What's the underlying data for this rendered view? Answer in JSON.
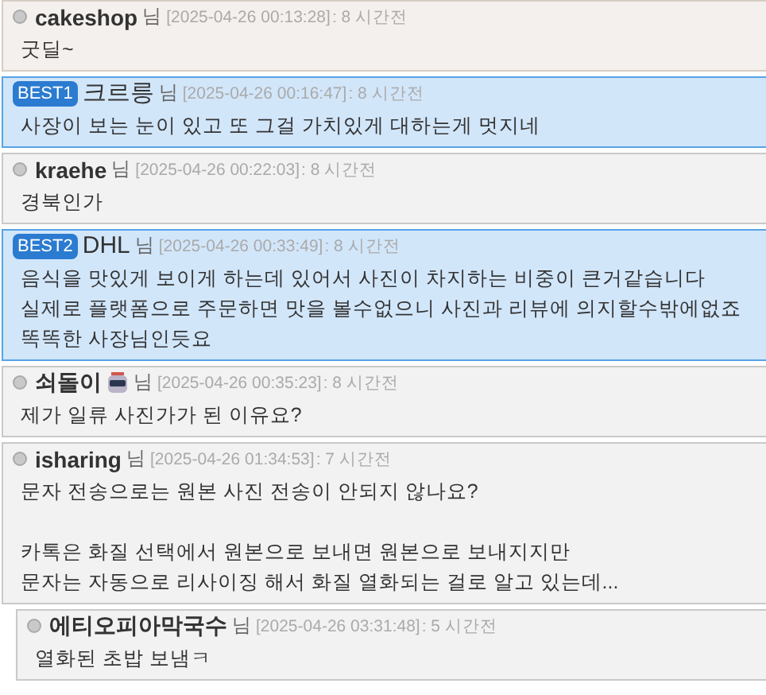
{
  "comments": [
    {
      "kind": "highlighted",
      "author": "cakeshop",
      "user_icon": false,
      "suffix": "님",
      "date": "[2025-04-26 00:13:28]",
      "ago": ": 8 시간전",
      "text": "굿딜~"
    },
    {
      "kind": "best",
      "badge": "BEST1",
      "author": "크르릉",
      "user_icon": false,
      "suffix": "님",
      "date": "[2025-04-26 00:16:47]",
      "ago": ": 8 시간전",
      "text": "사장이 보는 눈이 있고 또 그걸 가치있게 대하는게 멋지네"
    },
    {
      "kind": "normal",
      "author": "kraehe",
      "user_icon": false,
      "suffix": "님",
      "date": "[2025-04-26 00:22:03]",
      "ago": ": 8 시간전",
      "text": "경북인가"
    },
    {
      "kind": "best",
      "badge": "BEST2",
      "author": "DHL",
      "user_icon": false,
      "suffix": "님",
      "date": "[2025-04-26 00:33:49]",
      "ago": ": 8 시간전",
      "text": "음식을 맛있게 보이게 하는데 있어서 사진이 차지하는 비중이 큰거같습니다\n실제로 플랫폼으로 주문하면 맛을 볼수없으니 사진과 리뷰에 의지할수밖에없죠\n똑똑한 사장님인듯요"
    },
    {
      "kind": "normal",
      "author": "쇠돌이",
      "user_icon": true,
      "suffix": "님",
      "date": "[2025-04-26 00:35:23]",
      "ago": ": 8 시간전",
      "text": "제가 일류 사진가가 된 이유요?"
    },
    {
      "kind": "normal",
      "author": "isharing",
      "user_icon": false,
      "suffix": "님",
      "date": "[2025-04-26 01:34:53]",
      "ago": ": 7 시간전",
      "text": "문자 전송으로는 원본 사진 전송이 안되지 않나요?\n\n카톡은 화질 선택에서 원본으로 보내면 원본으로 보내지지만\n문자는 자동으로 리사이징 해서 화질 열화되는 걸로 알고 있는데...",
      "children": [
        {
          "kind": "normal",
          "author": "에티오피아막국수",
          "user_icon": false,
          "suffix": "님",
          "date": "[2025-04-26 03:31:48]",
          "ago": ": 5 시간전",
          "text": "열화된 초밥 보냄ㅋ"
        }
      ]
    }
  ]
}
